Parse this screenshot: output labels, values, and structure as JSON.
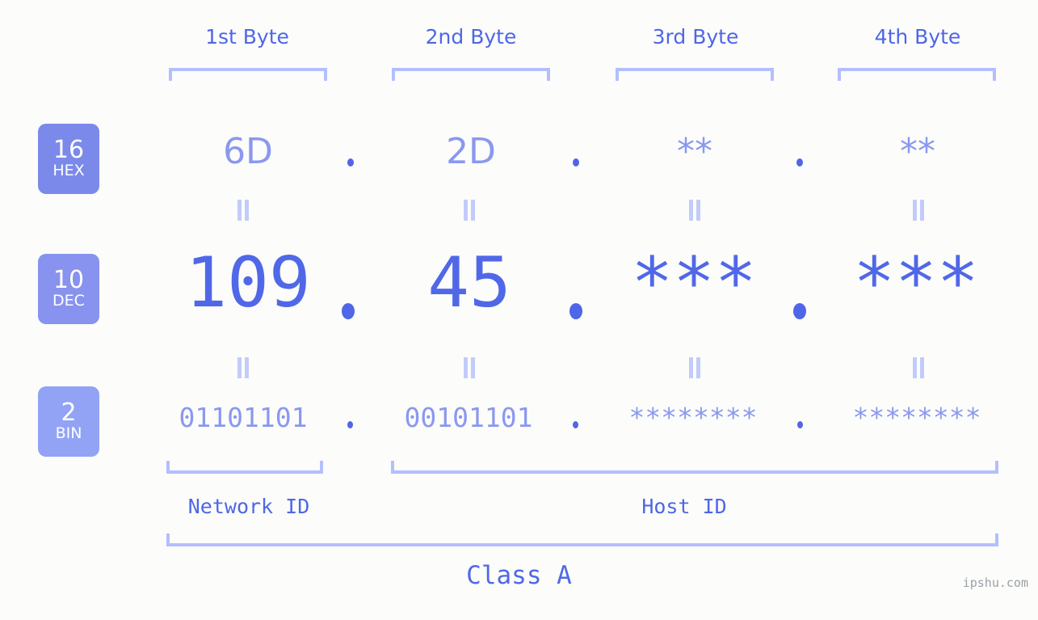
{
  "page": {
    "background": "#fcfdfa",
    "accent": "#5068e8",
    "muted_accent": "#8a98f0",
    "bracket_color": "#b4beff",
    "watermark": "ipshu.com"
  },
  "header": {
    "byte_labels": [
      {
        "label": "1st Byte"
      },
      {
        "label": "2nd Byte"
      },
      {
        "label": "3rd Byte"
      },
      {
        "label": "4th Byte"
      }
    ]
  },
  "bases": [
    {
      "number": "16",
      "name": "HEX",
      "color": "#7b8aea"
    },
    {
      "number": "10",
      "name": "DEC",
      "color": "#8793ee"
    },
    {
      "number": "2",
      "name": "BIN",
      "color": "#92a3f5"
    }
  ],
  "rows": {
    "hex": {
      "bytes": [
        "6D",
        "2D",
        "**",
        "**"
      ],
      "separator": "."
    },
    "dec": {
      "bytes": [
        "109",
        "45",
        "***",
        "***"
      ],
      "separator": "."
    },
    "bin": {
      "bytes": [
        "01101101",
        "00101101",
        "********",
        "********"
      ],
      "separator": "."
    }
  },
  "equals_marker": "=",
  "segments": {
    "network_id": "Network ID",
    "host_id": "Host ID"
  },
  "class": {
    "label": "Class A"
  },
  "chart_data": {
    "type": "table",
    "title": "IP address 109.45.*.* byte breakdown",
    "columns": [
      "1st Byte",
      "2nd Byte",
      "3rd Byte",
      "4th Byte"
    ],
    "rows": [
      {
        "base": "16 HEX",
        "values": [
          "6D",
          "2D",
          "**",
          "**"
        ]
      },
      {
        "base": "10 DEC",
        "values": [
          "109",
          "45",
          "***",
          "***"
        ]
      },
      {
        "base": "2 BIN",
        "values": [
          "01101101",
          "00101101",
          "********",
          "********"
        ]
      }
    ],
    "annotations": [
      "Network ID",
      "Host ID",
      "Class A"
    ]
  }
}
